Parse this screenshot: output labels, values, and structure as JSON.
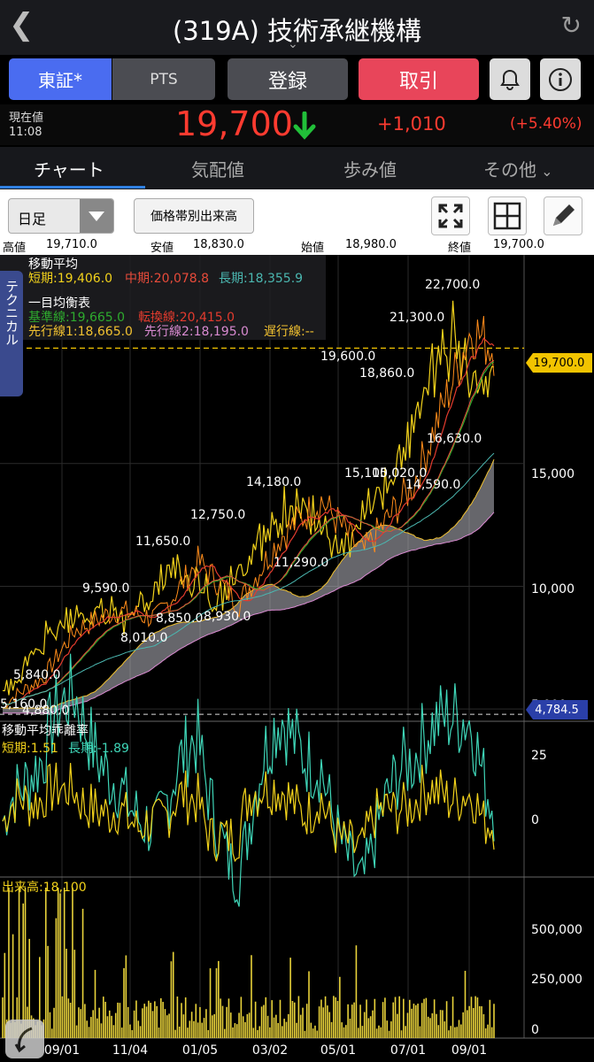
{
  "header": {
    "back_icon": "chevron-left-icon",
    "title": "(319A) 技術承継機構",
    "expand_icon": "chevron-down-icon",
    "refresh_icon": "refresh-icon"
  },
  "toolbar": {
    "market_tab": "東証*",
    "pts_tab": "PTS",
    "register": "登録",
    "trade": "取引",
    "bell_icon": "bell-icon",
    "info_icon": "info-icon",
    "colors": {
      "market": "#4a6cf0",
      "trade": "#e8455a",
      "gray": "#4b4c52"
    }
  },
  "quote": {
    "label": "現在値",
    "time": "11:08",
    "price": "19,700",
    "direction_icon": "arrow-down-icon",
    "change": "+1,010",
    "change_pct": "(+5.40%)",
    "colors": {
      "price": "#ff3b30",
      "change": "#ff3b30",
      "arrow": "#21c039"
    }
  },
  "tabs": [
    {
      "label": "チャート",
      "active": true
    },
    {
      "label": "気配値"
    },
    {
      "label": "歩み値"
    },
    {
      "label": "その他"
    }
  ],
  "controls": {
    "period": "日足",
    "volume_profile": "価格帯別出来高",
    "fullscreen_icon": "fullscreen-icon",
    "grid_icon": "grid-icon",
    "pencil_icon": "pencil-icon"
  },
  "ohlc": {
    "high_label": "高値",
    "high": "19,710.0",
    "low_label": "安値",
    "low": "18,830.0",
    "open_label": "始値",
    "open": "18,980.0",
    "close_label": "終値",
    "close": "19,700.0"
  },
  "side_tab": "テクニカル",
  "main_legend": {
    "ma_title": "移動平均",
    "ma_short": "短期:19,406.0",
    "ma_mid": "中期:20,078.8",
    "ma_long": "長期:18,355.9",
    "ichimoku_title": "一目均衡表",
    "kijun": "基準線:19,665.0",
    "tenkan": "転換線:20,415.0",
    "senko1": "先行線1:18,665.0",
    "senko2": "先行線2:18,195.0",
    "chikou": "遅行線:--"
  },
  "osc_legend": {
    "title": "移動平均乖離率",
    "short": "短期:1.51",
    "long": "長期:-1.89"
  },
  "volume_legend": {
    "title": "出来高:18,100"
  },
  "chart_data": {
    "type": "line",
    "price_axis": {
      "ticks": [
        "15,000",
        "10,000",
        "5,000"
      ],
      "ylim": [
        4500,
        23500
      ]
    },
    "current_price_tag": "19,700.0",
    "min_line_tag": "4,784.5",
    "x_ticks": [
      "09/01",
      "11/04",
      "01/05",
      "03/02",
      "05/01",
      "07/01",
      "09/01"
    ],
    "annotations": [
      "22,700.0",
      "21,300.0",
      "19,600.0",
      "18,860.0",
      "16,630.0",
      "15,100.0",
      "15,020.0",
      "14,590.0",
      "14,180.0",
      "12,750.0",
      "11,650.0",
      "11,290.0",
      "9,590.0",
      "8,850.0",
      "8,930.0",
      "8,010.0",
      "5,840.0",
      "5,160.0",
      "4,880.0"
    ],
    "oscillator_ticks": [
      "25",
      "0"
    ],
    "volume_ticks": [
      "500,000",
      "250,000",
      "0"
    ],
    "series": [
      {
        "name": "短期",
        "color": "#f2d21b"
      },
      {
        "name": "中期",
        "color": "#e84b3a"
      },
      {
        "name": "長期",
        "color": "#4bb7b0"
      },
      {
        "name": "基準線",
        "color": "#2eaa2e"
      },
      {
        "name": "転換線",
        "color": "#e23b2e"
      },
      {
        "name": "先行線1",
        "color": "#f0c030"
      },
      {
        "name": "先行線2",
        "color": "#d88ad0"
      }
    ]
  }
}
